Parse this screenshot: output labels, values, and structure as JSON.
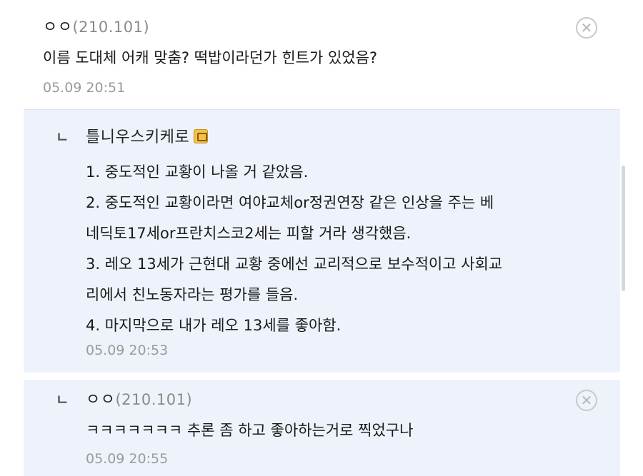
{
  "comment": {
    "author": "ㅇㅇ",
    "ip": "(210.101)",
    "text": "이름 도대체 어캐 맞춤? 떡밥이라던가 힌트가 있었음?",
    "timestamp": "05.09 20:51",
    "close_icon": "close-icon"
  },
  "reply1": {
    "marker": "ㄴ",
    "author": "틀니우스키케로",
    "badge_icon": "gallery-badge-icon",
    "lines": [
      "1. 중도적인 교황이 나올 거 같았음.",
      "2. 중도적인 교황이라면 여야교체or정권연장 같은 인상을 주는 베",
      "네딕토17세or프란치스코2세는 피할 거라 생각했음.",
      "3. 레오 13세가 근현대 교황 중에선 교리적으로 보수적이고 사회교",
      "리에서 친노동자라는 평가를 들음.",
      "4. 마지막으로 내가 레오 13세를 좋아함."
    ],
    "timestamp": "05.09 20:53"
  },
  "reply2": {
    "marker": "ㄴ",
    "author": "ㅇㅇ",
    "ip": "(210.101)",
    "text": "ㅋㅋㅋㅋㅋㅋㅋ 추론 좀 하고 좋아하는거로 찍었구나",
    "timestamp": "05.09 20:55",
    "close_icon": "close-icon"
  }
}
